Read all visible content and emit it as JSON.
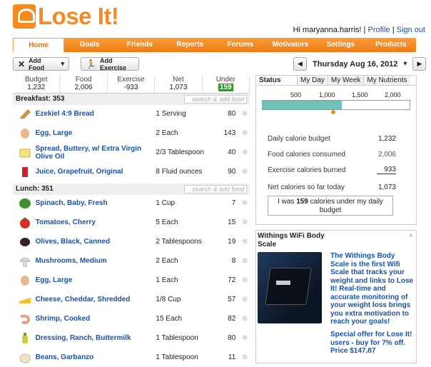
{
  "app": {
    "logo_text": "Lose It!"
  },
  "user": {
    "greeting": "Hi maryanna.harris!",
    "sep": "|",
    "profile": "Profile",
    "signout": "Sign out"
  },
  "nav": [
    "Home",
    "Goals",
    "Friends",
    "Reports",
    "Forums",
    "Motivators",
    "Settings",
    "Products"
  ],
  "toolbar": {
    "add_food": "Add Food",
    "add_food_arrow": "▾",
    "add_exercise": "Add Exercise"
  },
  "date": {
    "prev": "◀",
    "label": "Thursday Aug 16, 2012",
    "next": "▶",
    "chevron": "▾"
  },
  "summary": [
    {
      "label": "Budget",
      "value": "1,232"
    },
    {
      "label": "Food",
      "value": "2,006"
    },
    {
      "label": "Exercise",
      "value": "-933"
    },
    {
      "label": "Net",
      "value": "1,073"
    },
    {
      "label": "Under",
      "value": "159"
    }
  ],
  "sections": {
    "breakfast": {
      "label": "Breakfast: 353"
    },
    "lunch": {
      "label": "Lunch: 351",
      "search_placeholder": "search & add food"
    }
  },
  "search_placeholder": "search & add food",
  "breakfast_items": [
    {
      "name": "Ezekiel 4:9 Bread",
      "qty": "1 Serving",
      "cal": "80",
      "icon": "bread-icon"
    },
    {
      "name": "Egg, Large",
      "qty": "2 Each",
      "cal": "143",
      "icon": "egg-icon"
    },
    {
      "name": "Spread, Buttery, w/ Extra Virgin Olive Oil",
      "qty": "2/3 Tablespoon",
      "cal": "40",
      "icon": "butter-icon"
    },
    {
      "name": "Juice, Grapefruit, Original",
      "qty": "8 Fluid ounces",
      "cal": "90",
      "icon": "juice-icon"
    }
  ],
  "lunch_items": [
    {
      "name": "Spinach, Baby, Fresh",
      "qty": "1 Cup",
      "cal": "7",
      "icon": "spinach-icon"
    },
    {
      "name": "Tomatoes, Cherry",
      "qty": "5 Each",
      "cal": "15",
      "icon": "tomato-icon"
    },
    {
      "name": "Olives, Black, Canned",
      "qty": "2 Tablespoons",
      "cal": "19",
      "icon": "olive-icon"
    },
    {
      "name": "Mushrooms, Medium",
      "qty": "2 Each",
      "cal": "8",
      "icon": "mushroom-icon"
    },
    {
      "name": "Egg, Large",
      "qty": "1 Each",
      "cal": "72",
      "icon": "egg-icon"
    },
    {
      "name": "Cheese, Cheddar, Shredded",
      "qty": "1/8 Cup",
      "cal": "57",
      "icon": "cheese-icon"
    },
    {
      "name": "Shrimp, Cooked",
      "qty": "15 Each",
      "cal": "82",
      "icon": "shrimp-icon"
    },
    {
      "name": "Dressing, Ranch, Buttermilk",
      "qty": "1 Tablespoon",
      "cal": "80",
      "icon": "dressing-icon"
    },
    {
      "name": "Beans, Garbanzo",
      "qty": "1 Tablespoon",
      "cal": "11",
      "icon": "bean-icon"
    }
  ],
  "remove_glyph": "⊗",
  "status": {
    "tabs": [
      "Status",
      "My Day",
      "My Week",
      "My Nutrients"
    ],
    "scale_ticks": [
      "500",
      "1,000",
      "1,500",
      "2,000"
    ],
    "progress_fraction": 0.54,
    "marker_value": 1073,
    "rows": [
      {
        "label": "Daily calorie budget",
        "value": "1,232"
      },
      {
        "label": "Food calories consumed",
        "value": "2,006"
      },
      {
        "label": "Exercise calories burned",
        "value": "933"
      },
      {
        "label": "Net calories so far today",
        "value": "1,073"
      }
    ],
    "under_message_pre": "I was",
    "under_message_num": "159",
    "under_message_post": "calories under my daily budget"
  },
  "ad": {
    "title": "Withings WiFi Body Scale",
    "close": "×",
    "body": "The Withings Body Scale is the first Wifi Scale that tracks your weight and links to Lose It! Real-time and accurate monitoring of your weight loss brings you extra motivation to reach your goals!",
    "offer": "Special offer for Lose It! users - buy for 7% off. Price",
    "price": "$147.87"
  },
  "colors": {
    "brand": "#f58a1f",
    "link": "#1a52a8",
    "under": "#2e9b2b",
    "bar": "#6cc3b8"
  }
}
